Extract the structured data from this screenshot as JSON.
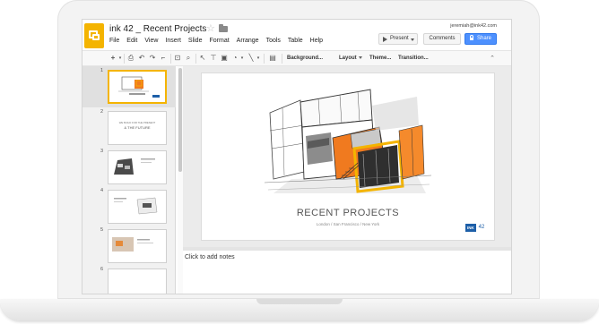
{
  "doc": {
    "title": "ink 42 _ Recent Projects",
    "user_email": "jeremiah@ink42.com"
  },
  "menu": [
    "File",
    "Edit",
    "View",
    "Insert",
    "Slide",
    "Format",
    "Arrange",
    "Tools",
    "Table",
    "Help"
  ],
  "buttons": {
    "present": "Present",
    "comments": "Comments",
    "share": "Share"
  },
  "toolbar": {
    "background": "Background...",
    "layout": "Layout",
    "theme": "Theme...",
    "transition": "Transition..."
  },
  "filmstrip": {
    "slide_numbers": [
      "1",
      "2",
      "3",
      "4",
      "5",
      "6"
    ],
    "slide2_line1": "WE BUILD FOR THE PRESENT",
    "slide2_line2": "& THE FUTURE"
  },
  "slide": {
    "title": "RECENT PROJECTS",
    "subtitle": "London / San Francisco / New York",
    "logo_word": "INK",
    "logo_number": "42"
  },
  "notes": {
    "placeholder": "Click to add notes"
  },
  "colors": {
    "logo_yellow": "#f4b400",
    "share_blue": "#4d90fe",
    "accent_orange": "#f07a1f",
    "ink_blue": "#1d5fa8"
  }
}
